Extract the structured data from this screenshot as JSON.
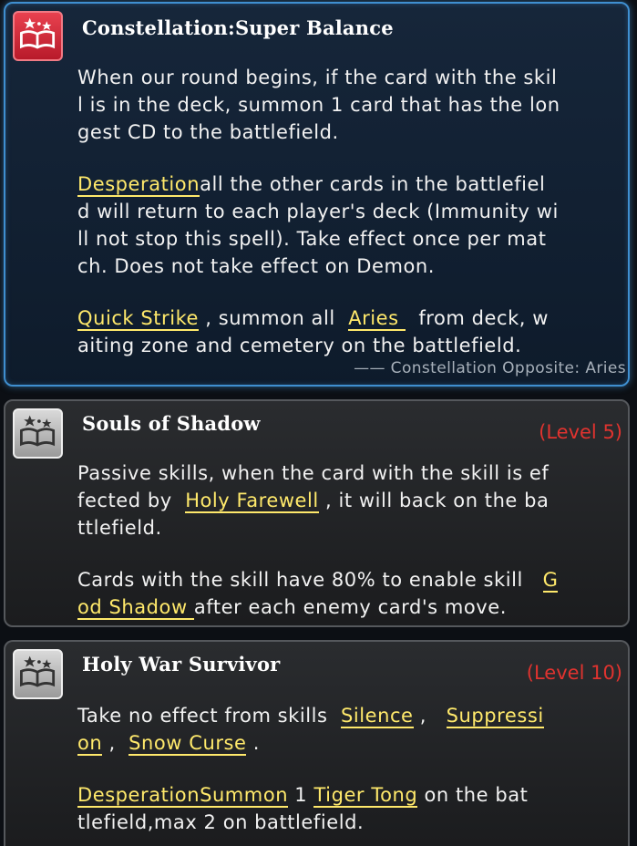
{
  "skills": [
    {
      "title": "Constellation:Super Balance",
      "level": "",
      "quote": "—— Constellation Opposite: Aries",
      "lines": [
        [
          {
            "t": "When our round begins, if the card with the skil"
          }
        ],
        [
          {
            "t": "l is in the deck, summon 1 card that has the lon"
          }
        ],
        [
          {
            "t": "gest CD to the battlefield."
          }
        ],
        [],
        [
          {
            "t": "Desperation",
            "k": true
          },
          {
            "t": "all the other cards in the battlefiel"
          }
        ],
        [
          {
            "t": "d will return to each player's deck (Immunity wi"
          }
        ],
        [
          {
            "t": "ll not stop this spell). Take effect once per mat"
          }
        ],
        [
          {
            "t": "ch. Does not take effect on Demon."
          }
        ],
        [],
        [
          {
            "t": "Quick Strike",
            "k": true
          },
          {
            "t": " , summon all  "
          },
          {
            "t": "Aries ",
            "k": true
          },
          {
            "t": "  from deck, w"
          }
        ],
        [
          {
            "t": "aiting zone and cemetery on the battlefield."
          }
        ]
      ]
    },
    {
      "title": "Souls of Shadow",
      "level": "(Level 5)",
      "lines": [
        [
          {
            "t": "Passive skills, when the card with the skill is ef"
          }
        ],
        [
          {
            "t": "fected by  "
          },
          {
            "t": "Holy Farewell",
            "k": true
          },
          {
            "t": " , it will back on the ba"
          }
        ],
        [
          {
            "t": "ttlefield."
          }
        ],
        [],
        [
          {
            "t": "Cards with the skill have 80% to enable skill   "
          },
          {
            "t": "G",
            "k": true
          }
        ],
        [
          {
            "t": "od Shadow ",
            "k": true
          },
          {
            "t": "after each enemy card's move."
          }
        ]
      ]
    },
    {
      "title": "Holy War Survivor",
      "level": "(Level 10)",
      "lines": [
        [
          {
            "t": "Take no effect from skills  "
          },
          {
            "t": "Silence",
            "k": true
          },
          {
            "t": " ,   "
          },
          {
            "t": "Suppressi",
            "k": true
          }
        ],
        [
          {
            "t": "on",
            "k": true
          },
          {
            "t": " ,  "
          },
          {
            "t": "Snow Curse",
            "k": true
          },
          {
            "t": " ."
          }
        ],
        [],
        [
          {
            "t": "Desperation",
            "k": true
          },
          {
            "t": "Summon",
            "k": true
          },
          {
            "t": " 1 "
          },
          {
            "t": "Tiger Tong",
            "k": true
          },
          {
            "t": " on the bat"
          }
        ],
        [
          {
            "t": "tlefield,max 2 on battlefield."
          }
        ]
      ]
    }
  ],
  "icons": [
    "book-stars-icon",
    "book-stars-icon",
    "book-stars-icon"
  ],
  "colors": {
    "keyword": "#ffe96b",
    "level": "#e0332f",
    "accent_border": "#3f8fd0"
  }
}
